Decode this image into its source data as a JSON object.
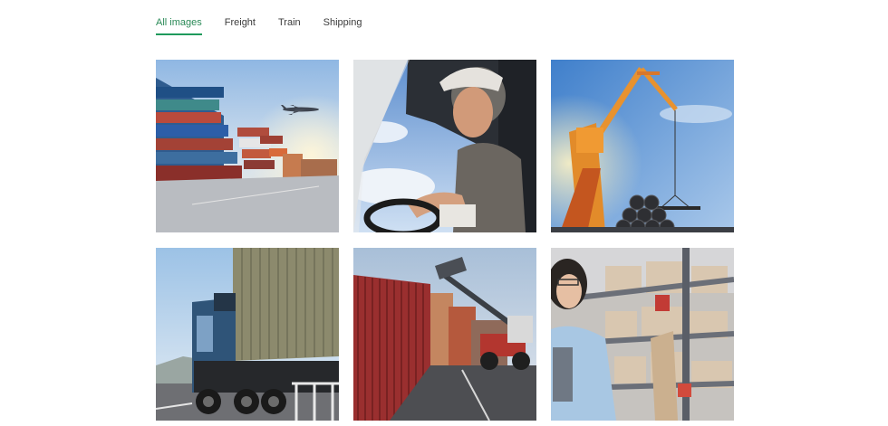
{
  "tabs": [
    {
      "label": "All images",
      "active": true
    },
    {
      "label": "Freight",
      "active": false
    },
    {
      "label": "Train",
      "active": false
    },
    {
      "label": "Shipping",
      "active": false
    }
  ],
  "accent_color": "#1f9a5c",
  "gallery": [
    {
      "subject": "containers-airplane-photo"
    },
    {
      "subject": "truck-driver-photo"
    },
    {
      "subject": "port-crane-pipes-photo"
    },
    {
      "subject": "container-truck-photo"
    },
    {
      "subject": "container-yard-forklift-photo"
    },
    {
      "subject": "warehouse-worker-tablet-photo"
    }
  ]
}
